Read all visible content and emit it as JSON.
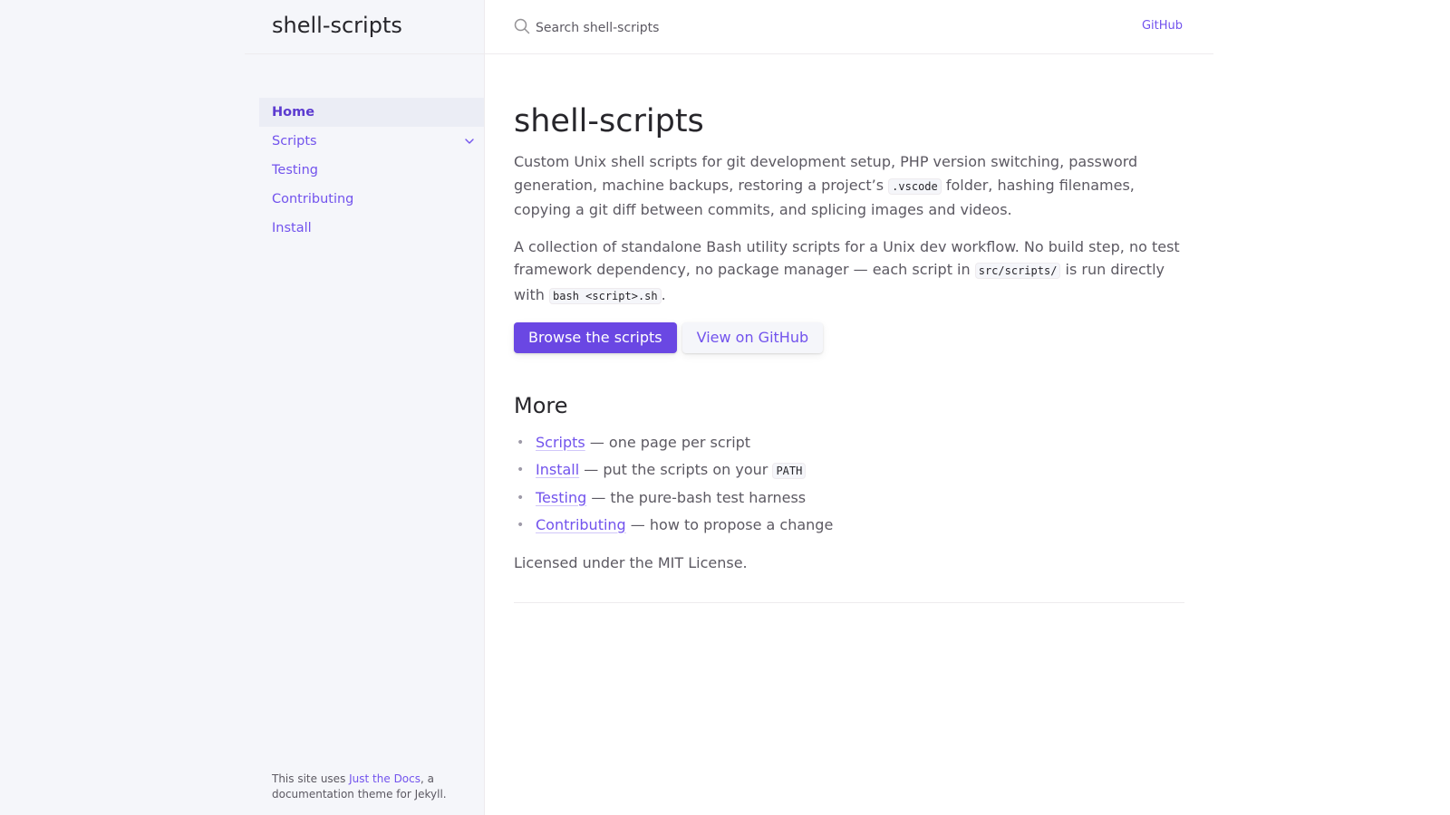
{
  "site": {
    "title": "shell-scripts"
  },
  "search": {
    "placeholder": "Search shell-scripts"
  },
  "header": {
    "aux_link": "GitHub"
  },
  "sidebar": {
    "items": [
      {
        "label": "Home",
        "active": true
      },
      {
        "label": "Scripts",
        "expandable": true
      },
      {
        "label": "Testing"
      },
      {
        "label": "Contributing"
      },
      {
        "label": "Install"
      }
    ],
    "footer": {
      "prefix": "This site uses ",
      "link": "Just the Docs",
      "suffix": ", a documentation theme for Jekyll."
    }
  },
  "main": {
    "title": "shell-scripts",
    "intro": {
      "before": "Custom Unix shell scripts for git development setup, PHP version switching, password generation, machine backups, restoring a project’s ",
      "code": ".vscode",
      "after": " folder, hashing filenames, copying a git diff between commits, and splicing images and videos."
    },
    "collection": {
      "before": "A collection of standalone Bash utility scripts for a Unix dev workflow. No build step, no test framework dependency, no package manager — each script in ",
      "code1": "src/scripts/",
      "middle": " is run directly with ",
      "code2": "bash <script>.sh",
      "after": "."
    },
    "buttons": {
      "primary": "Browse the scripts",
      "secondary": "View on GitHub"
    },
    "more": {
      "heading": "More",
      "items": [
        {
          "link": "Scripts",
          "text": " — one page per script"
        },
        {
          "link": "Install",
          "text": " — put the scripts on your ",
          "code": "PATH"
        },
        {
          "link": "Testing",
          "text": " — the pure-bash test harness"
        },
        {
          "link": "Contributing",
          "text": " — how to propose a change"
        }
      ]
    },
    "license": "Licensed under the MIT License."
  },
  "colors": {
    "accent": "#7253ed",
    "primary_button": "#6a47e3",
    "sidebar_bg": "#f5f6fa",
    "heading": "#27262b",
    "body_text": "#5c5962"
  },
  "icons": {
    "search": "search-icon",
    "expander": "chevron-down-icon"
  }
}
